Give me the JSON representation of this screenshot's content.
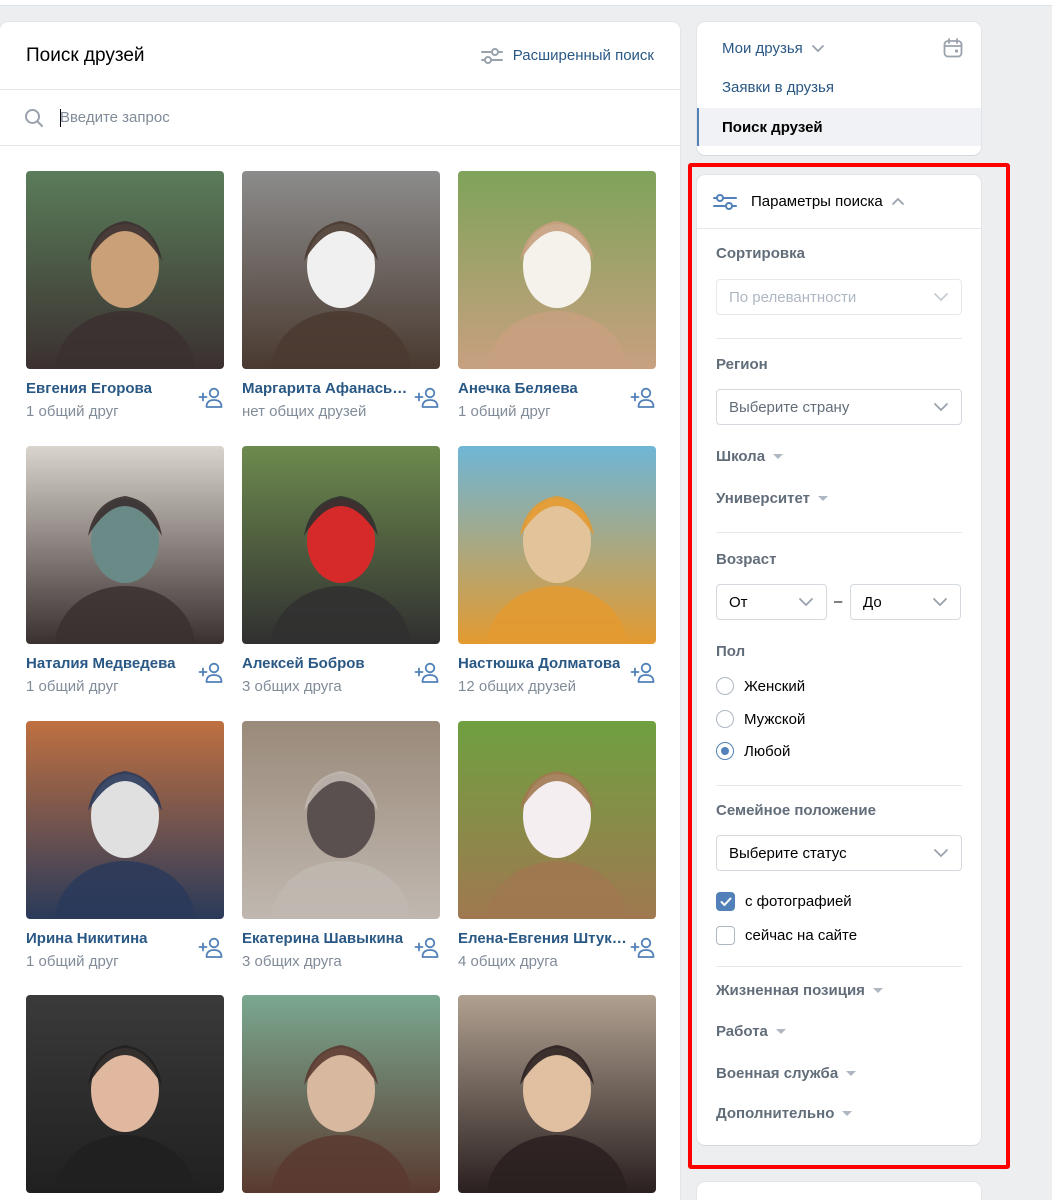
{
  "header": {
    "title": "Поиск друзей",
    "advanced_search": "Расширенный поиск"
  },
  "search": {
    "placeholder": "Введите запрос",
    "value": ""
  },
  "people": [
    {
      "name": "Евгения Егорова",
      "mutual": "1 общий друг",
      "photo_colors": [
        "#5a7d5a",
        "#c9a078",
        "#3b3030"
      ]
    },
    {
      "name": "Маргарита Афанасьева",
      "mutual": "нет общих друзей",
      "photo_colors": [
        "#8c8c8c",
        "#f0f0f0",
        "#4a3a30"
      ]
    },
    {
      "name": "Анечка Беляева",
      "mutual": "1 общий друг",
      "photo_colors": [
        "#7fa35a",
        "#f4f2ea",
        "#c8a080"
      ]
    },
    {
      "name": "Наталия Медведева",
      "mutual": "1 общий друг",
      "photo_colors": [
        "#d9d4cc",
        "#6a8a88",
        "#3a3030"
      ]
    },
    {
      "name": "Алексей Бобров",
      "mutual": "3 общих друга",
      "photo_colors": [
        "#6d8a4e",
        "#d62a2a",
        "#303030"
      ]
    },
    {
      "name": "Настюшка Долматова",
      "mutual": "12 общих друзей",
      "photo_colors": [
        "#6fb6d6",
        "#e3c49a",
        "#e39a30"
      ]
    },
    {
      "name": "Ирина Никитина",
      "mutual": "1 общий друг",
      "photo_colors": [
        "#c07040",
        "#e0e0e0",
        "#2a3a5a"
      ]
    },
    {
      "name": "Екатерина Шавыкина",
      "mutual": "3 общих друга",
      "photo_colors": [
        "#9a8a7a",
        "#5a5050",
        "#c0b8b0"
      ]
    },
    {
      "name": "Елена-Евгения Штукатурова",
      "mutual": "4 общих друга",
      "photo_colors": [
        "#6fa040",
        "#f4eef0",
        "#a07850"
      ]
    },
    {
      "name": "",
      "mutual": "",
      "photo_colors": [
        "#3a3a3a",
        "#e0b8a0",
        "#202020"
      ]
    },
    {
      "name": "",
      "mutual": "",
      "photo_colors": [
        "#7aa890",
        "#d9b8a0",
        "#5a3a30"
      ]
    },
    {
      "name": "",
      "mutual": "",
      "photo_colors": [
        "#b0a090",
        "#e0c0a0",
        "#2a2020"
      ]
    }
  ],
  "nav": {
    "my_friends": "Мои друзья",
    "requests": "Заявки в друзья",
    "find_friends": "Поиск друзей"
  },
  "filters": {
    "title": "Параметры поиска",
    "sort_label": "Сортировка",
    "sort_value": "По релевантности",
    "region_label": "Регион",
    "country_placeholder": "Выберите страну",
    "school_label": "Школа",
    "university_label": "Университет",
    "age_label": "Возраст",
    "age_from": "От",
    "age_dash": "–",
    "age_to": "До",
    "gender_label": "Пол",
    "gender_options": [
      "Женский",
      "Мужской",
      "Любой"
    ],
    "gender_selected": "Любой",
    "marital_label": "Семейное положение",
    "marital_placeholder": "Выберите статус",
    "with_photo": "с фотографией",
    "with_photo_checked": true,
    "online_now": "сейчас на сайте",
    "online_now_checked": false,
    "life_position": "Жизненная позиция",
    "work": "Работа",
    "military": "Военная служба",
    "additional": "Дополнительно"
  },
  "colors": {
    "link": "#2a5885",
    "accent": "#5181b8",
    "secondary_text": "#818c99",
    "highlight_box": "#ff0000"
  }
}
